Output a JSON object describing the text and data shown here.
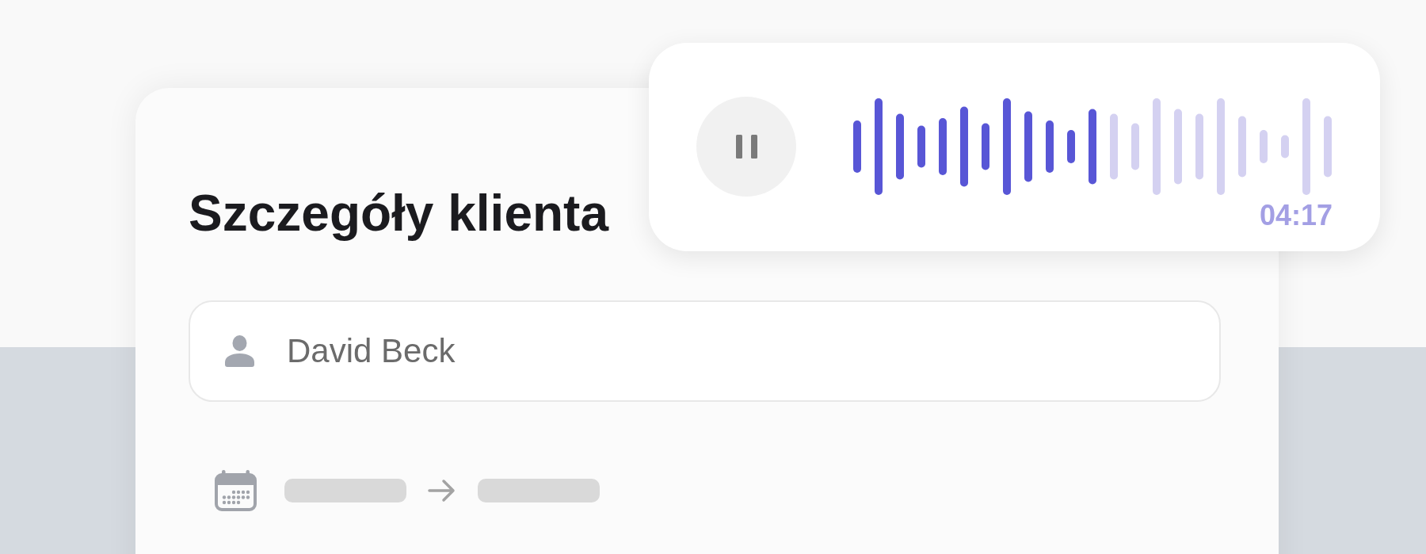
{
  "card": {
    "title": "Szczegóły klienta",
    "customer_field": {
      "value": "David Beck"
    }
  },
  "player": {
    "playing": true,
    "level": 0.52,
    "time": "04:17"
  }
}
